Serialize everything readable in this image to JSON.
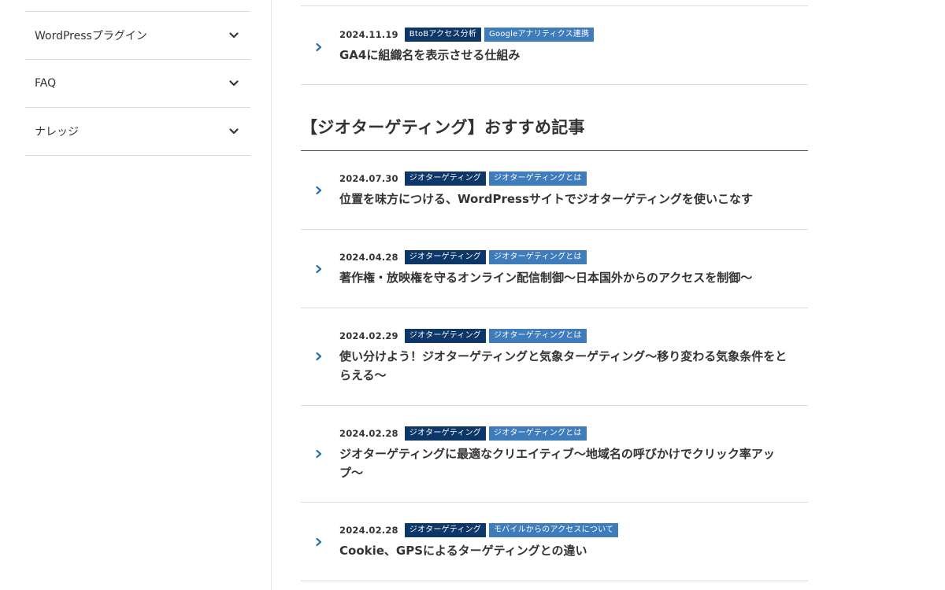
{
  "sidebar": {
    "items": [
      {
        "label": "WordPressプラグイン"
      },
      {
        "label": "FAQ"
      },
      {
        "label": "ナレッジ"
      }
    ]
  },
  "top_article": {
    "date": "2024.11.19",
    "tags": [
      "BtoBアクセス分析",
      "Googleアナリティクス連携"
    ],
    "title": "GA4に組織名を表示させる仕組み"
  },
  "section": {
    "heading": "【ジオターゲティング】おすすめ記事"
  },
  "articles": [
    {
      "date": "2024.07.30",
      "tags": [
        "ジオターゲティング",
        "ジオターゲティングとは"
      ],
      "title": "位置を味方につける、WordPressサイトでジオターゲティングを使いこなす"
    },
    {
      "date": "2024.04.28",
      "tags": [
        "ジオターゲティング",
        "ジオターゲティングとは"
      ],
      "title": "著作権・放映権を守るオンライン配信制御〜日本国外からのアクセスを制御〜"
    },
    {
      "date": "2024.02.29",
      "tags": [
        "ジオターゲティング",
        "ジオターゲティングとは"
      ],
      "title": "使い分けよう！ジオターゲティングと気象ターゲティング〜移り変わる気象条件をとらえる〜"
    },
    {
      "date": "2024.02.28",
      "tags": [
        "ジオターゲティング",
        "ジオターゲティングとは"
      ],
      "title": "ジオターゲティングに最適なクリエイティブ〜地域名の呼びかけでクリック率アップ〜"
    },
    {
      "date": "2024.02.28",
      "tags": [
        "ジオターゲティング",
        "モバイルからのアクセスについて"
      ],
      "title": "Cookie、GPSによるターゲティングとの違い"
    }
  ],
  "colors": {
    "tag_dark": "#0d3768",
    "tag_light": "#3f7cbb",
    "arrow": "#2a6fb0"
  },
  "icons": {
    "sidebar_chevron": "chevron-down-icon",
    "article_arrow": "chevron-right-icon"
  }
}
